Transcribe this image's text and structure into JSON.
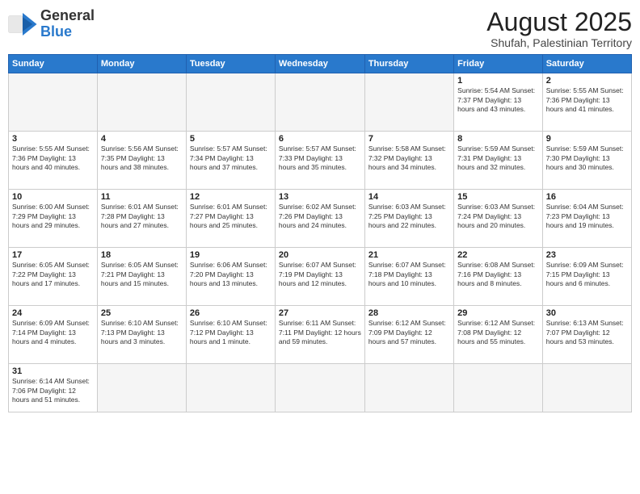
{
  "header": {
    "logo_general": "General",
    "logo_blue": "Blue",
    "main_title": "August 2025",
    "subtitle": "Shufah, Palestinian Territory"
  },
  "weekdays": [
    "Sunday",
    "Monday",
    "Tuesday",
    "Wednesday",
    "Thursday",
    "Friday",
    "Saturday"
  ],
  "weeks": [
    [
      {
        "day": "",
        "info": ""
      },
      {
        "day": "",
        "info": ""
      },
      {
        "day": "",
        "info": ""
      },
      {
        "day": "",
        "info": ""
      },
      {
        "day": "",
        "info": ""
      },
      {
        "day": "1",
        "info": "Sunrise: 5:54 AM\nSunset: 7:37 PM\nDaylight: 13 hours\nand 43 minutes."
      },
      {
        "day": "2",
        "info": "Sunrise: 5:55 AM\nSunset: 7:36 PM\nDaylight: 13 hours\nand 41 minutes."
      }
    ],
    [
      {
        "day": "3",
        "info": "Sunrise: 5:55 AM\nSunset: 7:36 PM\nDaylight: 13 hours\nand 40 minutes."
      },
      {
        "day": "4",
        "info": "Sunrise: 5:56 AM\nSunset: 7:35 PM\nDaylight: 13 hours\nand 38 minutes."
      },
      {
        "day": "5",
        "info": "Sunrise: 5:57 AM\nSunset: 7:34 PM\nDaylight: 13 hours\nand 37 minutes."
      },
      {
        "day": "6",
        "info": "Sunrise: 5:57 AM\nSunset: 7:33 PM\nDaylight: 13 hours\nand 35 minutes."
      },
      {
        "day": "7",
        "info": "Sunrise: 5:58 AM\nSunset: 7:32 PM\nDaylight: 13 hours\nand 34 minutes."
      },
      {
        "day": "8",
        "info": "Sunrise: 5:59 AM\nSunset: 7:31 PM\nDaylight: 13 hours\nand 32 minutes."
      },
      {
        "day": "9",
        "info": "Sunrise: 5:59 AM\nSunset: 7:30 PM\nDaylight: 13 hours\nand 30 minutes."
      }
    ],
    [
      {
        "day": "10",
        "info": "Sunrise: 6:00 AM\nSunset: 7:29 PM\nDaylight: 13 hours\nand 29 minutes."
      },
      {
        "day": "11",
        "info": "Sunrise: 6:01 AM\nSunset: 7:28 PM\nDaylight: 13 hours\nand 27 minutes."
      },
      {
        "day": "12",
        "info": "Sunrise: 6:01 AM\nSunset: 7:27 PM\nDaylight: 13 hours\nand 25 minutes."
      },
      {
        "day": "13",
        "info": "Sunrise: 6:02 AM\nSunset: 7:26 PM\nDaylight: 13 hours\nand 24 minutes."
      },
      {
        "day": "14",
        "info": "Sunrise: 6:03 AM\nSunset: 7:25 PM\nDaylight: 13 hours\nand 22 minutes."
      },
      {
        "day": "15",
        "info": "Sunrise: 6:03 AM\nSunset: 7:24 PM\nDaylight: 13 hours\nand 20 minutes."
      },
      {
        "day": "16",
        "info": "Sunrise: 6:04 AM\nSunset: 7:23 PM\nDaylight: 13 hours\nand 19 minutes."
      }
    ],
    [
      {
        "day": "17",
        "info": "Sunrise: 6:05 AM\nSunset: 7:22 PM\nDaylight: 13 hours\nand 17 minutes."
      },
      {
        "day": "18",
        "info": "Sunrise: 6:05 AM\nSunset: 7:21 PM\nDaylight: 13 hours\nand 15 minutes."
      },
      {
        "day": "19",
        "info": "Sunrise: 6:06 AM\nSunset: 7:20 PM\nDaylight: 13 hours\nand 13 minutes."
      },
      {
        "day": "20",
        "info": "Sunrise: 6:07 AM\nSunset: 7:19 PM\nDaylight: 13 hours\nand 12 minutes."
      },
      {
        "day": "21",
        "info": "Sunrise: 6:07 AM\nSunset: 7:18 PM\nDaylight: 13 hours\nand 10 minutes."
      },
      {
        "day": "22",
        "info": "Sunrise: 6:08 AM\nSunset: 7:16 PM\nDaylight: 13 hours\nand 8 minutes."
      },
      {
        "day": "23",
        "info": "Sunrise: 6:09 AM\nSunset: 7:15 PM\nDaylight: 13 hours\nand 6 minutes."
      }
    ],
    [
      {
        "day": "24",
        "info": "Sunrise: 6:09 AM\nSunset: 7:14 PM\nDaylight: 13 hours\nand 4 minutes."
      },
      {
        "day": "25",
        "info": "Sunrise: 6:10 AM\nSunset: 7:13 PM\nDaylight: 13 hours\nand 3 minutes."
      },
      {
        "day": "26",
        "info": "Sunrise: 6:10 AM\nSunset: 7:12 PM\nDaylight: 13 hours\nand 1 minute."
      },
      {
        "day": "27",
        "info": "Sunrise: 6:11 AM\nSunset: 7:11 PM\nDaylight: 12 hours\nand 59 minutes."
      },
      {
        "day": "28",
        "info": "Sunrise: 6:12 AM\nSunset: 7:09 PM\nDaylight: 12 hours\nand 57 minutes."
      },
      {
        "day": "29",
        "info": "Sunrise: 6:12 AM\nSunset: 7:08 PM\nDaylight: 12 hours\nand 55 minutes."
      },
      {
        "day": "30",
        "info": "Sunrise: 6:13 AM\nSunset: 7:07 PM\nDaylight: 12 hours\nand 53 minutes."
      }
    ],
    [
      {
        "day": "31",
        "info": "Sunrise: 6:14 AM\nSunset: 7:06 PM\nDaylight: 12 hours\nand 51 minutes."
      },
      {
        "day": "",
        "info": ""
      },
      {
        "day": "",
        "info": ""
      },
      {
        "day": "",
        "info": ""
      },
      {
        "day": "",
        "info": ""
      },
      {
        "day": "",
        "info": ""
      },
      {
        "day": "",
        "info": ""
      }
    ]
  ]
}
